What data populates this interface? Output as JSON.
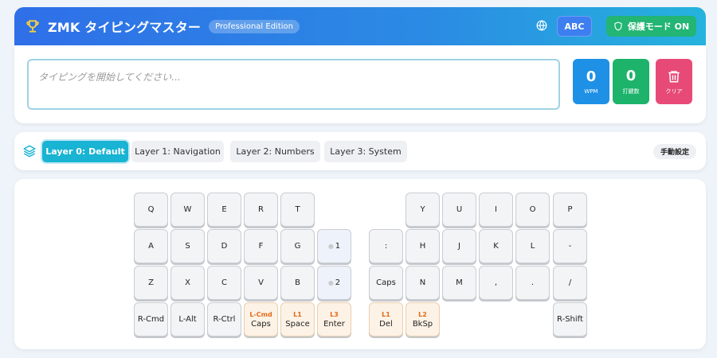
{
  "header": {
    "title": "ZMK タイピングマスター",
    "edition": "Professional Edition",
    "lang_label": "ABC",
    "protect_label": "保護モード ON"
  },
  "input": {
    "placeholder": "タイピングを開始してください..."
  },
  "stats": {
    "wpm_value": "0",
    "wpm_label": "WPM",
    "count_value": "0",
    "count_label": "打鍵数",
    "clear_label": "クリア"
  },
  "layers": {
    "tabs": [
      {
        "label": "Layer 0: Default"
      },
      {
        "label": "Layer 1: Navigation"
      },
      {
        "label": "Layer 2: Numbers"
      },
      {
        "label": "Layer 3: System"
      }
    ],
    "manual_label": "手動設定"
  },
  "keyboard": {
    "left": [
      [
        "Q",
        "W",
        "E",
        "R",
        "T",
        ""
      ],
      [
        "A",
        "S",
        "D",
        "F",
        "G",
        "1"
      ],
      [
        "Z",
        "X",
        "C",
        "V",
        "B",
        "2"
      ],
      [
        "R-Cmd",
        "L-Alt",
        "R-Ctrl",
        {
          "sub": "L-Cmd",
          "main": "Caps"
        },
        {
          "sub": "L1",
          "main": "Space"
        },
        {
          "sub": "L3",
          "main": "Enter"
        }
      ]
    ],
    "right": [
      [
        "",
        "Y",
        "U",
        "I",
        "O",
        "P"
      ],
      [
        ":",
        "H",
        "J",
        "K",
        "L",
        "-"
      ],
      [
        "Caps",
        "N",
        "M",
        ",",
        ".",
        "/"
      ],
      [
        {
          "sub": "L1",
          "main": "Del"
        },
        {
          "sub": "L2",
          "main": "BkSp"
        },
        "",
        "",
        "",
        "R-Shift"
      ]
    ]
  },
  "colors": {
    "accent": "#19b3d3",
    "wpm": "#1e90e6",
    "count": "#1db36a",
    "clear": "#e84a78",
    "protect": "#22b573"
  }
}
